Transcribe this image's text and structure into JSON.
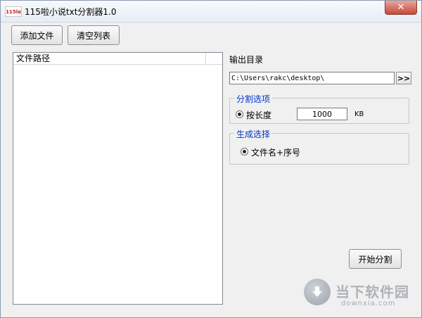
{
  "window": {
    "title": "115啦小说txt分割器1.0",
    "icon_text": "115lα",
    "close_glyph": "✕"
  },
  "toolbar": {
    "add_file_label": "添加文件",
    "clear_list_label": "清空列表"
  },
  "file_list": {
    "columns": [
      "文件路径"
    ],
    "rows": []
  },
  "output": {
    "label": "输出目录",
    "path_value": "C:\\Users\\rakc\\desktop\\",
    "browse_label": ">>"
  },
  "split_options": {
    "title": "分割选项",
    "by_length_label": "按长度",
    "length_value": "1000",
    "unit": "KB"
  },
  "generate": {
    "title": "生成选择",
    "filename_option_label": "文件名+序号"
  },
  "actions": {
    "start_label": "开始分割"
  },
  "watermark": {
    "title": "当下软件园",
    "subtitle": "downxia.com"
  },
  "colors": {
    "group_title": "#0033cc",
    "close_button": "#c7473a",
    "window_bg": "#f0f0f0"
  }
}
